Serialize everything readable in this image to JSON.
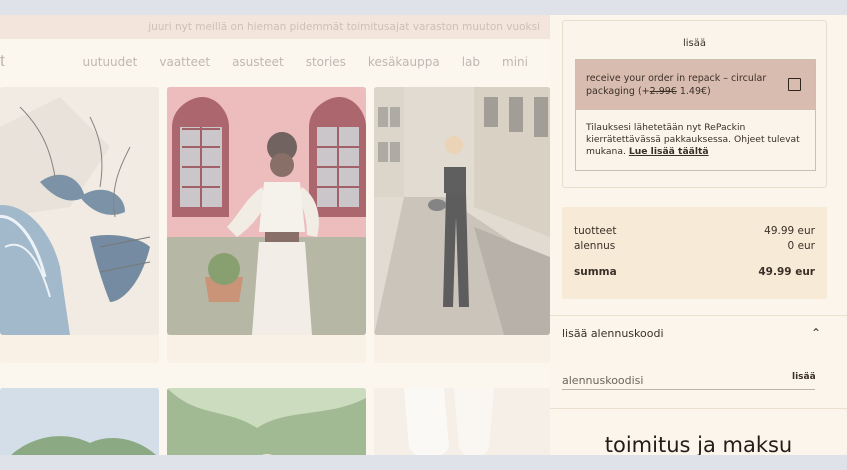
{
  "announcement": "juuri nyt meillä on hieman pidemmät toimitusajat varaston muuton vuoksi",
  "logo_fragment": "t",
  "nav": [
    "uutuudet",
    "vaatteet",
    "asusteet",
    "stories",
    "kesäkauppa",
    "lab",
    "mini"
  ],
  "cart": {
    "addons_title": "lisää",
    "repack": {
      "label_main": "receive your order in repack – circular packaging (+",
      "old_price": "2.99€",
      "new_price": " 1.49€)",
      "checked": false,
      "info_text": "Tilauksesi lähetetään nyt RePackin kierrätettävässä pakkauksessa. Ohjeet tulevat mukana.",
      "info_link": "Lue lisää täältä"
    },
    "totals": {
      "products_label": "tuotteet",
      "products_value": "49.99 eur",
      "discount_label": "alennus",
      "discount_value": "0 eur",
      "sum_label": "summa",
      "sum_value": "49.99 eur"
    },
    "discount": {
      "toggle_label": "lisää alennuskoodi",
      "placeholder": "alennuskoodisi",
      "apply_label": "lisää"
    },
    "shipping_title": "toimitus ja maksu"
  },
  "colors": {
    "panel_bg": "#fbf5ec",
    "repack_highlight": "#d9bcb0",
    "totals_bg": "#f7ebd8"
  }
}
